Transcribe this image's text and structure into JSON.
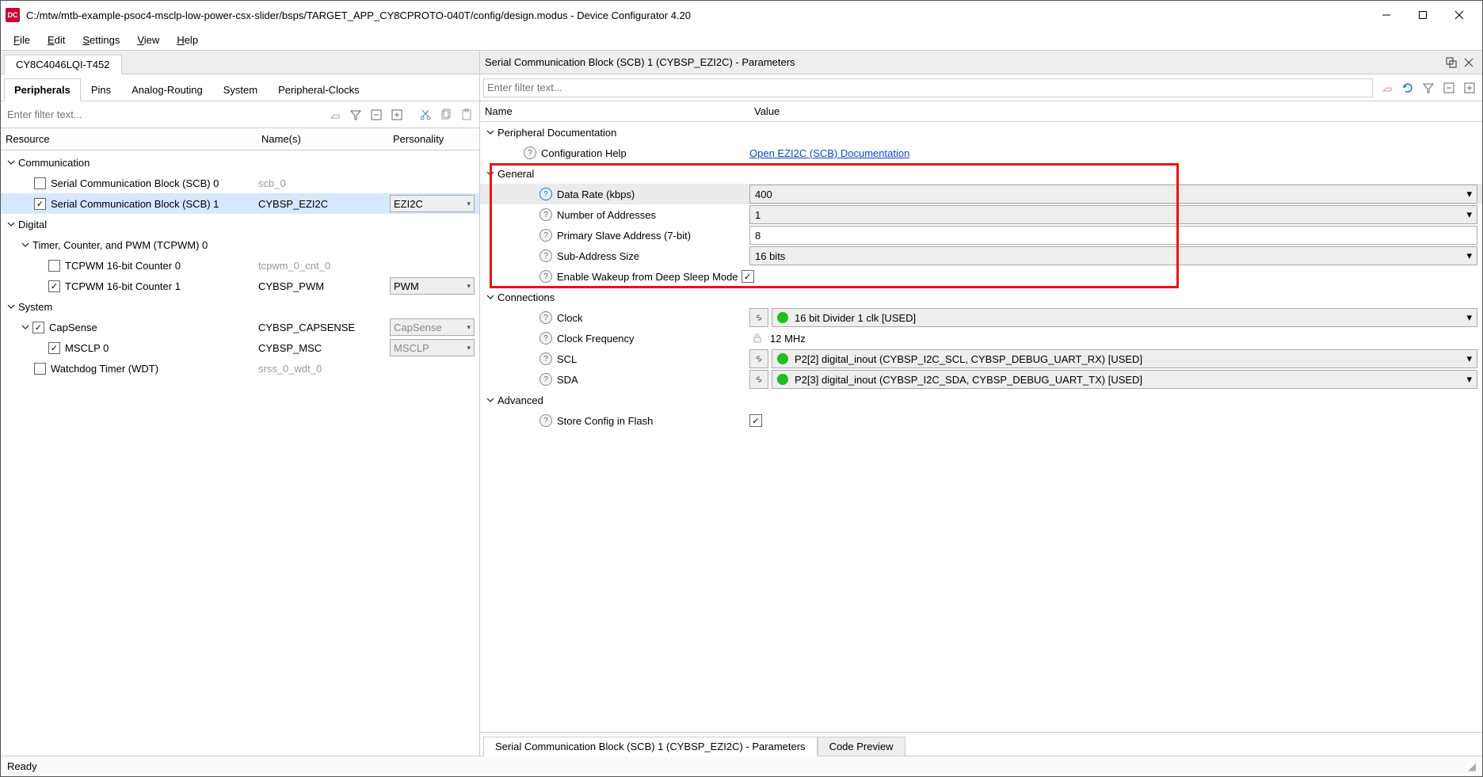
{
  "window": {
    "title": "C:/mtw/mtb-example-psoc4-msclp-low-power-csx-slider/bsps/TARGET_APP_CY8CPROTO-040T/config/design.modus - Device Configurator 4.20"
  },
  "menu": {
    "file": "File",
    "edit": "Edit",
    "settings": "Settings",
    "view": "View",
    "help": "Help"
  },
  "device_tab": "CY8C4046LQI-T452",
  "left": {
    "tabs": {
      "peripherals": "Peripherals",
      "pins": "Pins",
      "analog": "Analog-Routing",
      "system": "System",
      "pclocks": "Peripheral-Clocks"
    },
    "filter_placeholder": "Enter filter text...",
    "headers": {
      "resource": "Resource",
      "names": "Name(s)",
      "personality": "Personality"
    },
    "tree": {
      "communication": "Communication",
      "scb0": {
        "label": "Serial Communication Block (SCB) 0",
        "name": "scb_0"
      },
      "scb1": {
        "label": "Serial Communication Block (SCB) 1",
        "name": "CYBSP_EZI2C",
        "personality": "EZI2C"
      },
      "digital": "Digital",
      "tcpwm0": "Timer, Counter, and PWM (TCPWM) 0",
      "cnt0": {
        "label": "TCPWM 16-bit Counter 0",
        "name": "tcpwm_0_cnt_0"
      },
      "cnt1": {
        "label": "TCPWM 16-bit Counter 1",
        "name": "CYBSP_PWM",
        "personality": "PWM"
      },
      "system": "System",
      "capsense": {
        "label": "CapSense",
        "name": "CYBSP_CAPSENSE",
        "personality": "CapSense"
      },
      "msclp": {
        "label": "MSCLP 0",
        "name": "CYBSP_MSC",
        "personality": "MSCLP"
      },
      "wdt": {
        "label": "Watchdog Timer (WDT)",
        "name": "srss_0_wdt_0"
      }
    }
  },
  "right": {
    "panel_title": "Serial Communication Block (SCB) 1 (CYBSP_EZI2C) - Parameters",
    "filter_placeholder": "Enter filter text...",
    "headers": {
      "name": "Name",
      "value": "Value"
    },
    "sections": {
      "periph_doc": "Peripheral Documentation",
      "config_help": {
        "label": "Configuration Help",
        "link": "Open EZI2C (SCB) Documentation"
      },
      "general": "General",
      "data_rate": {
        "label": "Data Rate (kbps)",
        "value": "400"
      },
      "num_addr": {
        "label": "Number of Addresses",
        "value": "1"
      },
      "prim_addr": {
        "label": "Primary Slave Address (7-bit)",
        "value": "8"
      },
      "sub_addr": {
        "label": "Sub-Address Size",
        "value": "16 bits"
      },
      "wake": {
        "label": "Enable Wakeup from Deep Sleep Mode"
      },
      "connections": "Connections",
      "clock": {
        "label": "Clock",
        "value": "16 bit Divider 1 clk [USED]"
      },
      "clock_freq": {
        "label": "Clock Frequency",
        "value": "12 MHz"
      },
      "scl": {
        "label": "SCL",
        "value": "P2[2] digital_inout (CYBSP_I2C_SCL, CYBSP_DEBUG_UART_RX) [USED]"
      },
      "sda": {
        "label": "SDA",
        "value": "P2[3] digital_inout (CYBSP_I2C_SDA, CYBSP_DEBUG_UART_TX) [USED]"
      },
      "advanced": "Advanced",
      "store_flash": {
        "label": "Store Config in Flash"
      }
    },
    "bottom_tabs": {
      "params": "Serial Communication Block (SCB) 1 (CYBSP_EZI2C) - Parameters",
      "code": "Code Preview"
    }
  },
  "status": "Ready"
}
